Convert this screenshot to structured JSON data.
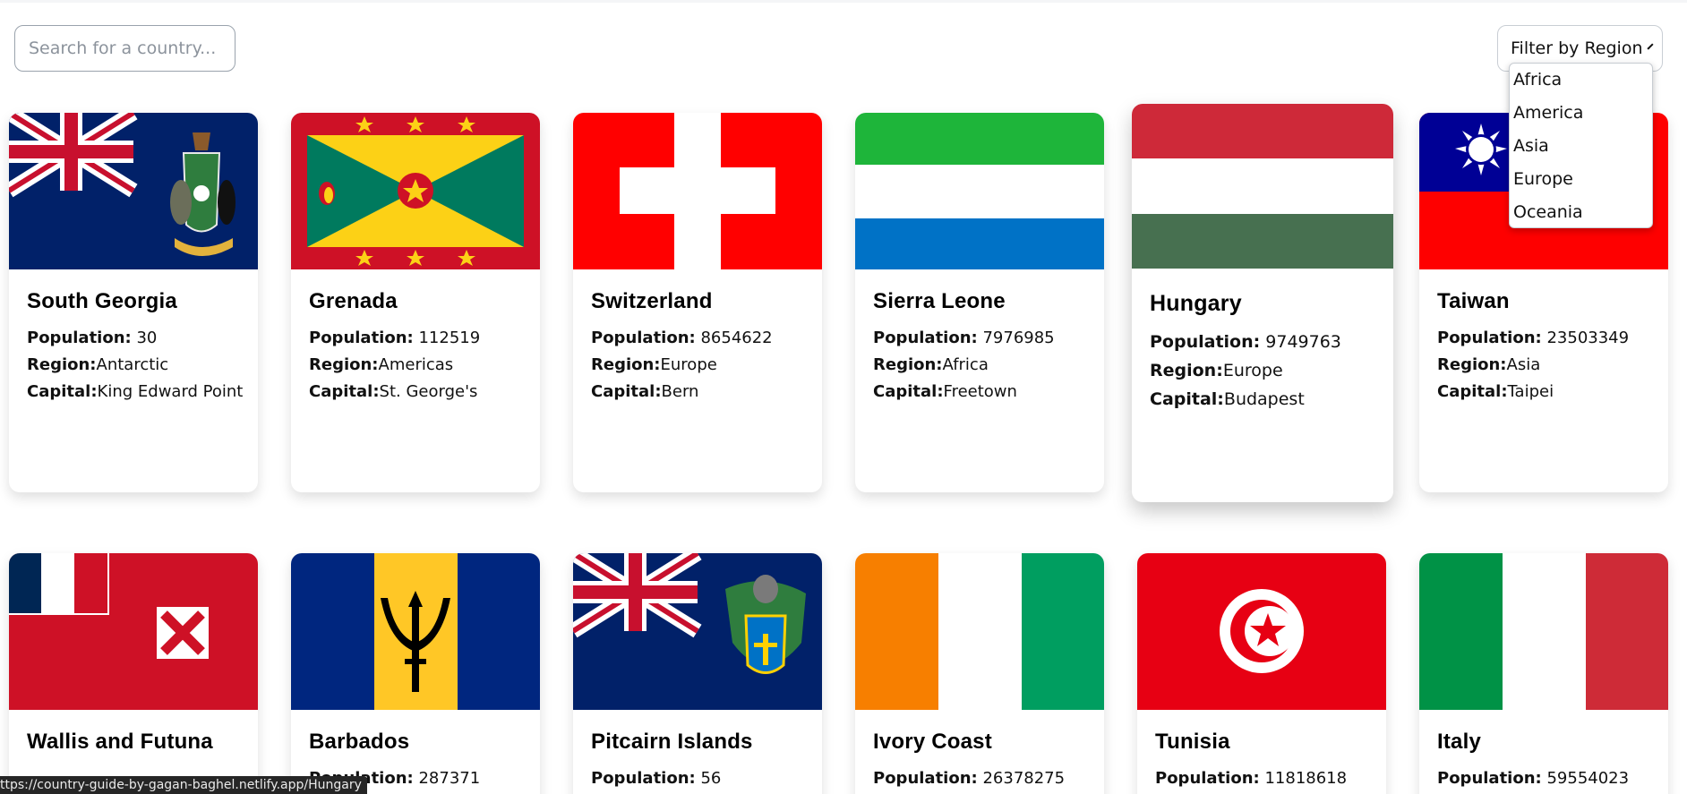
{
  "search": {
    "placeholder": "Search for a country...",
    "value": ""
  },
  "filter": {
    "label": "Filter by Region",
    "options": [
      "Africa",
      "America",
      "Asia",
      "Europe",
      "Oceania"
    ]
  },
  "labels": {
    "population": "Population:",
    "region": "Region:",
    "capital": "Capital:"
  },
  "countries": [
    {
      "name": "South Georgia",
      "population": "30",
      "region": "Antarctic",
      "capital": "King Edward Point"
    },
    {
      "name": "Grenada",
      "population": "112519",
      "region": "Americas",
      "capital": "St. George's"
    },
    {
      "name": "Switzerland",
      "population": "8654622",
      "region": "Europe",
      "capital": "Bern"
    },
    {
      "name": "Sierra Leone",
      "population": "7976985",
      "region": "Africa",
      "capital": "Freetown"
    },
    {
      "name": "Hungary",
      "population": "9749763",
      "region": "Europe",
      "capital": "Budapest"
    },
    {
      "name": "Taiwan",
      "population": "23503349",
      "region": "Asia",
      "capital": "Taipei"
    },
    {
      "name": "Wallis and Futuna",
      "population": "",
      "region": "",
      "capital": ""
    },
    {
      "name": "Barbados",
      "population": "287371",
      "region": "",
      "capital": ""
    },
    {
      "name": "Pitcairn Islands",
      "population": "56",
      "region": "",
      "capital": ""
    },
    {
      "name": "Ivory Coast",
      "population": "26378275",
      "region": "",
      "capital": ""
    },
    {
      "name": "Tunisia",
      "population": "11818618",
      "region": "",
      "capital": ""
    },
    {
      "name": "Italy",
      "population": "59554023",
      "region": "",
      "capital": ""
    }
  ],
  "status_bar": {
    "url": "ttps://country-guide-by-gagan-baghel.netlify.app/Hungary"
  },
  "colors": {
    "uk_blue": "#012169",
    "uk_red": "#c8102e",
    "swiss_red": "#ff0000",
    "sl_green": "#1eb53a",
    "sl_blue": "#0072c6",
    "hu_red": "#ce2939",
    "hu_green": "#477050",
    "tw_red": "#fe0000",
    "tw_blue": "#000095",
    "bb_blue": "#00267f",
    "bb_gold": "#ffc726",
    "ci_orange": "#f77f00",
    "ci_green": "#009e60",
    "tn_red": "#e70013",
    "it_green": "#009246",
    "it_red": "#ce2b37",
    "gd_red": "#ce1126",
    "gd_yellow": "#fcd116",
    "gd_green": "#007a5e"
  }
}
